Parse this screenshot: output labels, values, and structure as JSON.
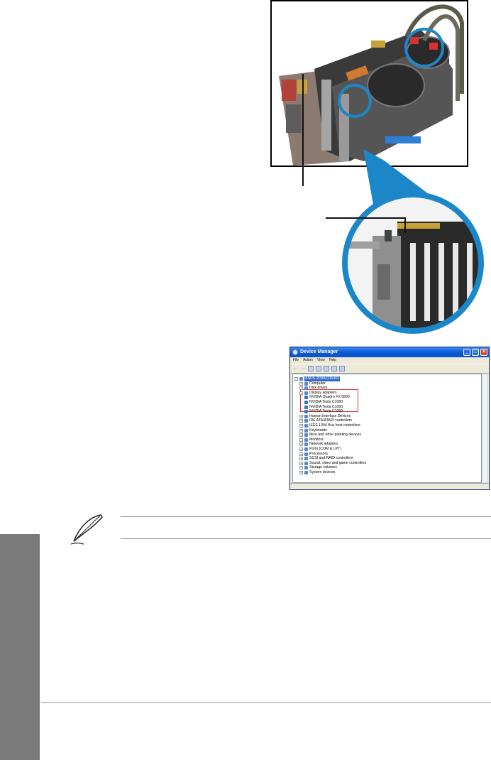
{
  "device_manager": {
    "title": "Device Manager",
    "menu": [
      "File",
      "Action",
      "View",
      "Help"
    ],
    "tree": [
      {
        "label": "ASUS-2D3ACD6403",
        "level": 0,
        "expander": "−",
        "selected": true
      },
      {
        "label": "Computer",
        "level": 1,
        "expander": "+"
      },
      {
        "label": "Disk drives",
        "level": 1,
        "expander": "+"
      },
      {
        "label": "Display adapters",
        "level": 1,
        "expander": "−"
      },
      {
        "label": "NVIDIA Quadro FX 5800",
        "level": 2,
        "expander": ""
      },
      {
        "label": "NVIDIA Tesla C1060",
        "level": 2,
        "expander": ""
      },
      {
        "label": "NVIDIA Tesla C1060",
        "level": 2,
        "expander": ""
      },
      {
        "label": "NVIDIA Tesla C1060",
        "level": 2,
        "expander": ""
      },
      {
        "label": "Human Interface Devices",
        "level": 1,
        "expander": "+"
      },
      {
        "label": "IDE ATA/ATAPI controllers",
        "level": 1,
        "expander": "+"
      },
      {
        "label": "IEEE 1394 Bus host controllers",
        "level": 1,
        "expander": "+"
      },
      {
        "label": "Keyboards",
        "level": 1,
        "expander": "+"
      },
      {
        "label": "Mice and other pointing devices",
        "level": 1,
        "expander": "+"
      },
      {
        "label": "Monitors",
        "level": 1,
        "expander": "+"
      },
      {
        "label": "Network adapters",
        "level": 1,
        "expander": "+"
      },
      {
        "label": "Ports (COM & LPT)",
        "level": 1,
        "expander": "+"
      },
      {
        "label": "Processors",
        "level": 1,
        "expander": "+"
      },
      {
        "label": "SCSI and RAID controllers",
        "level": 1,
        "expander": "+"
      },
      {
        "label": "Sound, video and game controllers",
        "level": 1,
        "expander": "+"
      },
      {
        "label": "Storage volumes",
        "level": 1,
        "expander": "+"
      },
      {
        "label": "System devices",
        "level": 1,
        "expander": "+"
      }
    ]
  },
  "colors": {
    "highlight": "#d6342a",
    "callout": "#1b87c9",
    "side_tab": "#7a7a7a"
  }
}
